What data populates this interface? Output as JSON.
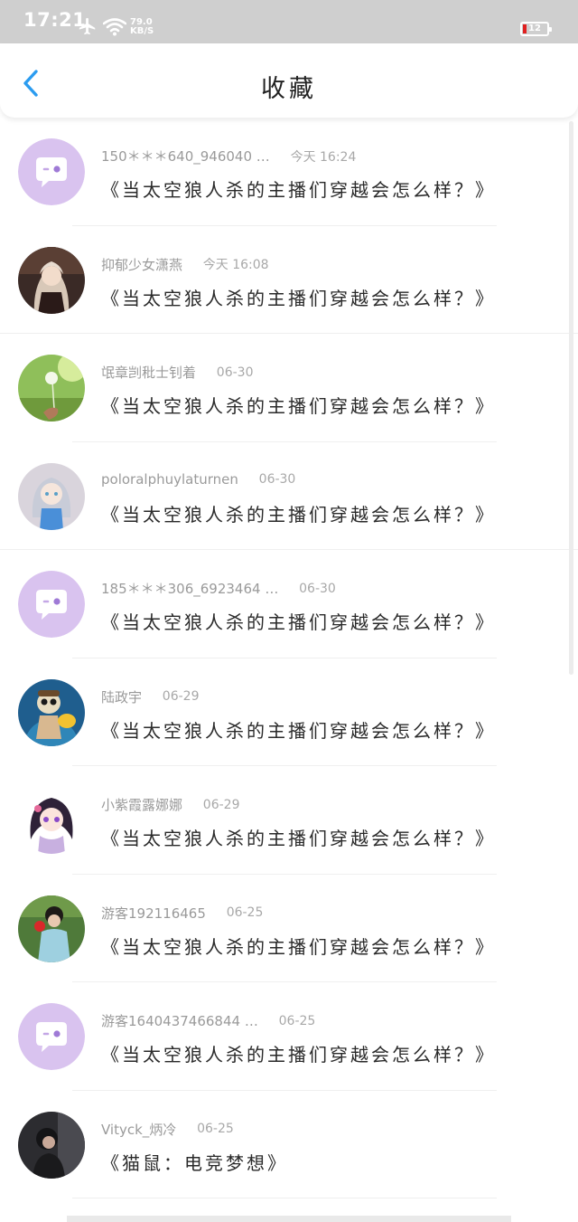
{
  "status_bar": {
    "time": "17:21",
    "speed_value": "79.0",
    "speed_unit": "KB/S",
    "battery": "12",
    "airplane_icon": "airplane-icon",
    "wifi_icon": "wifi-icon",
    "battery_color": "#e02020"
  },
  "header": {
    "title": "收藏",
    "back_icon": "chevron-left-icon",
    "accent": "#2b9cf0"
  },
  "favorites": [
    {
      "user": "150＊＊＊640_946040 …",
      "time": "今天 16:24",
      "content": "《当太空狼人杀的主播们穿越会怎么样？》",
      "avatar": "default-chat-avatar"
    },
    {
      "user": "抑郁少女潇燕",
      "time": "今天 16:08",
      "content": "《当太空狼人杀的主播们穿越会怎么样？》",
      "avatar": "anime-girl-dark-avatar"
    },
    {
      "user": "氓章剀秕士钊着",
      "time": "06-30",
      "content": "《当太空狼人杀的主播们穿越会怎么样？》",
      "avatar": "dandelion-photo-avatar"
    },
    {
      "user": "poloralphuylaturnen",
      "time": "06-30",
      "content": "《当太空狼人杀的主播们穿越会怎么样？》",
      "avatar": "anime-girl-silver-hair-avatar"
    },
    {
      "user": "185＊＊＊306_6923464 …",
      "time": "06-30",
      "content": "《当太空狼人杀的主播们穿越会怎么样？》",
      "avatar": "default-chat-avatar"
    },
    {
      "user": "陆政宇",
      "time": "06-29",
      "content": "《当太空狼人杀的主播们穿越会怎么样？》",
      "avatar": "skeleton-cartoon-avatar"
    },
    {
      "user": "小紫霞露娜娜",
      "time": "06-29",
      "content": "《当太空狼人杀的主播们穿越会怎么样？》",
      "avatar": "anime-girl-purple-avatar"
    },
    {
      "user": "游客192116465",
      "time": "06-25",
      "content": "《当太空狼人杀的主播们穿越会怎么样？》",
      "avatar": "person-flower-photo-avatar"
    },
    {
      "user": "游客1640437466844 …",
      "time": "06-25",
      "content": "《当太空狼人杀的主播们穿越会怎么样？》",
      "avatar": "default-chat-avatar"
    },
    {
      "user": "Vityck_炳冷",
      "time": "06-25",
      "content": "《猫鼠：电竞梦想》",
      "avatar": "person-dark-photo-avatar"
    }
  ]
}
